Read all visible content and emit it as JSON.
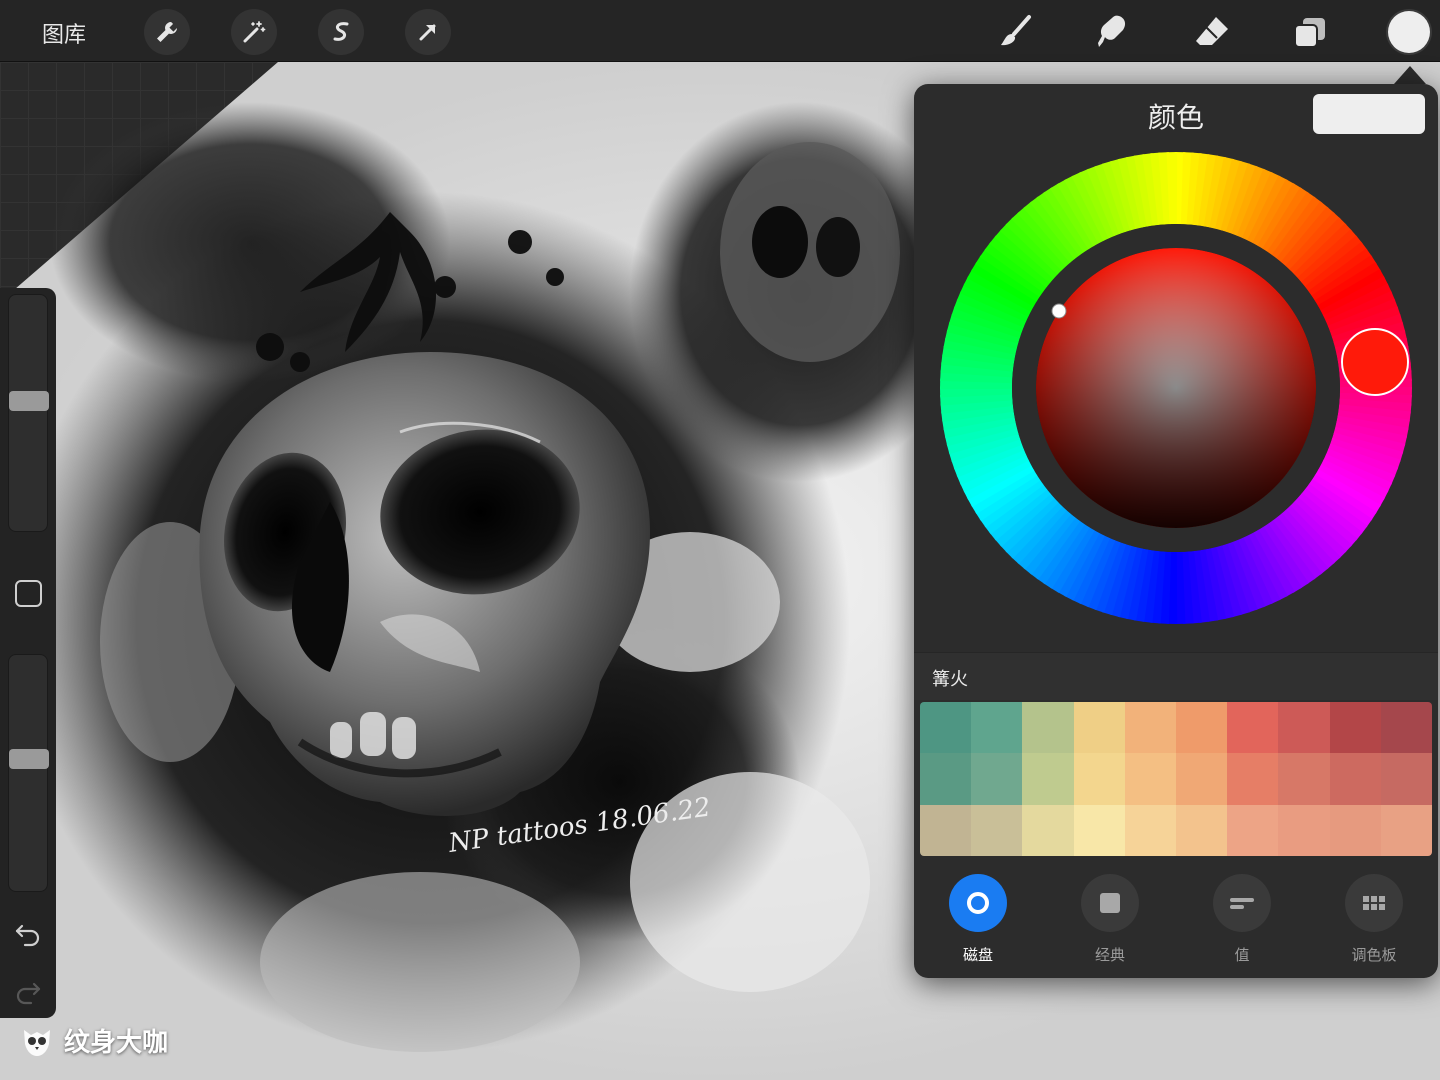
{
  "topbar": {
    "gallery_label": "图库",
    "left_tools": [
      "wrench-icon",
      "magic-wand-icon",
      "selection-icon",
      "transform-arrow-icon"
    ],
    "right_tools": [
      "brush-icon",
      "smudge-icon",
      "eraser-icon",
      "layers-icon",
      "color-swatch"
    ],
    "current_color": "#eeeeee"
  },
  "canvas": {
    "artwork_signature": "NP tattoos 18.06.22"
  },
  "color_panel": {
    "title": "颜色",
    "hue_color": "#ff1a0a",
    "palette_name": "篝火",
    "palette": [
      [
        "#4e9683",
        "#5fa58e",
        "#b4c38c",
        "#efcf86",
        "#f2b27a",
        "#ef9b6a",
        "#e2655b",
        "#cd5a57",
        "#b34648",
        "#a5474c"
      ],
      [
        "#5a9a84",
        "#70a88f",
        "#bfcb8f",
        "#f3d68e",
        "#f4bf83",
        "#f0a875",
        "#e67e66",
        "#d77867",
        "#cd6a60",
        "#c66a62"
      ],
      [
        "#c1b493",
        "#c9bf98",
        "#e4d99e",
        "#f8e7a8",
        "#f6d398",
        "#f3c38d",
        "#eda486",
        "#e99c81",
        "#e69a7f",
        "#e8a184"
      ]
    ],
    "tabs": [
      {
        "label": "磁盘",
        "icon": "disc-icon",
        "active": true
      },
      {
        "label": "经典",
        "icon": "classic-square-icon",
        "active": false
      },
      {
        "label": "值",
        "icon": "value-sliders-icon",
        "active": false
      },
      {
        "label": "调色板",
        "icon": "palette-grid-icon",
        "active": false
      }
    ]
  },
  "sidebar": {
    "brush_size_level": 0.56,
    "opacity_level": 0.57
  },
  "watermark": {
    "text": "纹身大咖"
  }
}
